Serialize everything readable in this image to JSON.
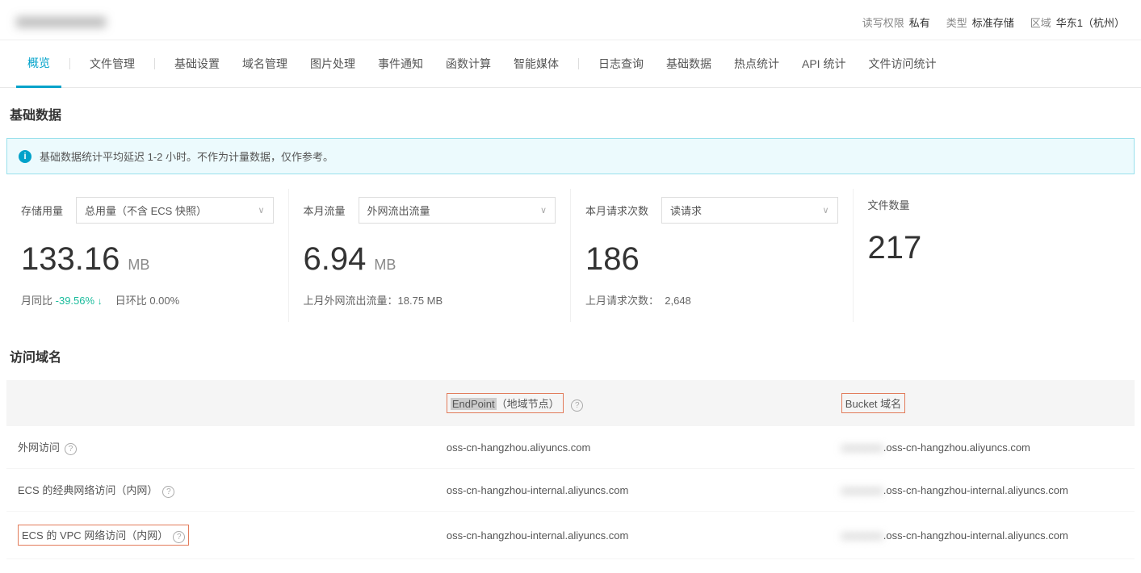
{
  "header": {
    "title_blur": "xxxxxxxxxx",
    "meta": {
      "perm_label": "读写权限",
      "perm_value": "私有",
      "type_label": "类型",
      "type_value": "标准存储",
      "region_label": "区域",
      "region_value": "华东1（杭州）"
    }
  },
  "tabs": {
    "overview": "概览",
    "files": "文件管理",
    "basic_settings": "基础设置",
    "domain": "域名管理",
    "image_proc": "图片处理",
    "event": "事件通知",
    "fc": "函数计算",
    "media": "智能媒体",
    "log_query": "日志查询",
    "basic_data": "基础数据",
    "hotspot": "热点统计",
    "api_stats": "API 统计",
    "file_access_stats": "文件访问统计"
  },
  "sections": {
    "basic_data_title": "基础数据",
    "alert": "基础数据统计平均延迟 1-2 小时。不作为计量数据，仅作参考。",
    "domain_title": "访问域名"
  },
  "metrics": {
    "storage": {
      "label": "存储用量",
      "select": "总用量（不含 ECS 快照）",
      "value": "133.16",
      "unit": "MB",
      "mom_label": "月同比",
      "mom_val": "-39.56%",
      "dod_label": "日环比",
      "dod_val": "0.00%"
    },
    "traffic": {
      "label": "本月流量",
      "select": "外网流出流量",
      "value": "6.94",
      "unit": "MB",
      "sub_label": "上月外网流出流量：",
      "sub_val": "18.75 MB"
    },
    "requests": {
      "label": "本月请求次数",
      "select": "读请求",
      "value": "186",
      "sub_label": "上月请求次数：",
      "sub_val": "2,648"
    },
    "files": {
      "label": "文件数量",
      "value": "217"
    }
  },
  "domains": {
    "th_endpoint_hl": "EndPoint",
    "th_endpoint_rest": "（地域节点）",
    "th_bucket": "Bucket 域名",
    "rows": [
      {
        "label": "外网访问",
        "endpoint": "oss-cn-hangzhou.aliyuncs.com",
        "bucket_blur": "xxxxxxxx",
        "bucket": ".oss-cn-hangzhou.aliyuncs.com",
        "highlight": false
      },
      {
        "label": "ECS 的经典网络访问（内网）",
        "endpoint": "oss-cn-hangzhou-internal.aliyuncs.com",
        "bucket_blur": "xxxxxxxx",
        "bucket": ".oss-cn-hangzhou-internal.aliyuncs.com",
        "highlight": false
      },
      {
        "label": "ECS 的 VPC 网络访问（内网）",
        "endpoint": "oss-cn-hangzhou-internal.aliyuncs.com",
        "bucket_blur": "xxxxxxxx",
        "bucket": ".oss-cn-hangzhou-internal.aliyuncs.com",
        "highlight": true
      }
    ]
  }
}
